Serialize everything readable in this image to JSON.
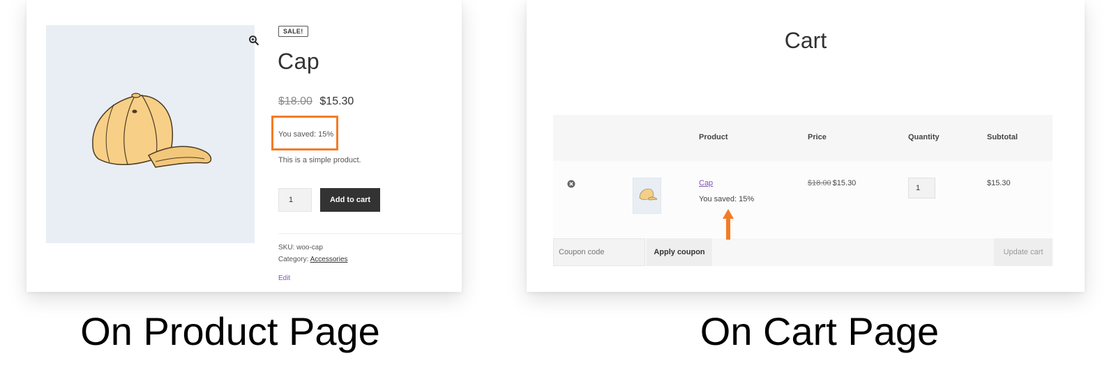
{
  "product_page": {
    "sale_badge": "SALE!",
    "title": "Cap",
    "old_price": "$18.00",
    "new_price": "$15.30",
    "saved_text": "You saved: 15%",
    "short_description": "This is a simple product.",
    "quantity": "1",
    "add_to_cart_label": "Add to cart",
    "sku": "SKU: woo-cap",
    "category_label": "Category:",
    "category_link": "Accessories",
    "edit_label": "Edit"
  },
  "cart_page": {
    "title": "Cart",
    "columns": {
      "product": "Product",
      "price": "Price",
      "quantity": "Quantity",
      "subtotal": "Subtotal"
    },
    "item": {
      "name": "Cap",
      "saved_text": "You saved: 15%",
      "old_price": "$18.00",
      "new_price": "$15.30",
      "quantity": "1",
      "subtotal": "$15.30"
    },
    "coupon_placeholder": "Coupon code",
    "apply_coupon_label": "Apply coupon",
    "update_cart_label": "Update cart"
  },
  "captions": {
    "product": "On Product Page",
    "cart": "On Cart Page"
  },
  "colors": {
    "highlight": "#f47b25",
    "link": "#7f54b3",
    "dark_button": "#333333",
    "image_bg": "#e9eef4"
  },
  "icons": {
    "zoom": "zoom-in-icon",
    "remove": "remove-circle-icon",
    "arrow": "arrow-up-icon"
  }
}
